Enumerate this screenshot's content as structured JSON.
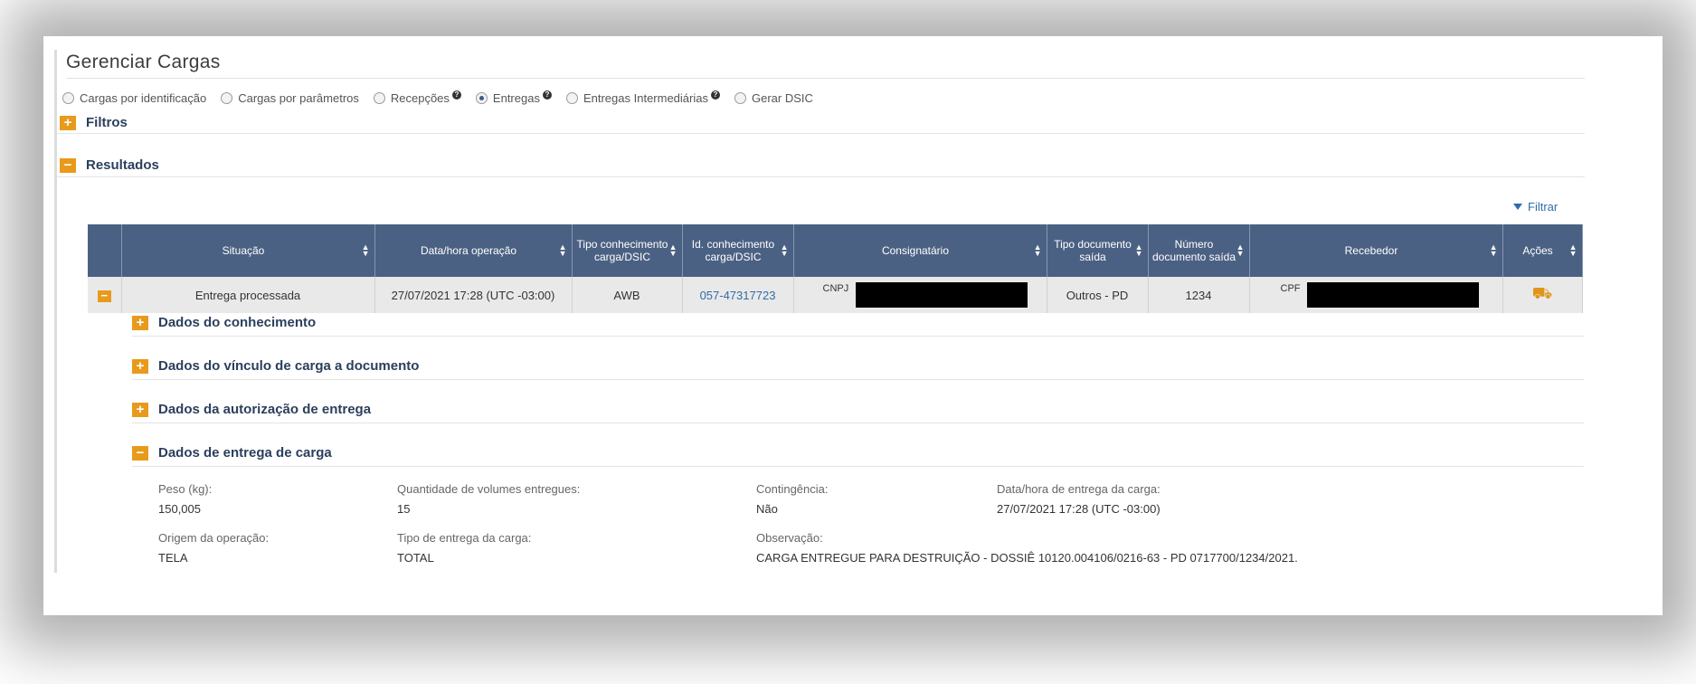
{
  "page_title": "Gerenciar Cargas",
  "radio_options": [
    {
      "label": "Cargas por identificação",
      "checked": false,
      "info": false
    },
    {
      "label": "Cargas por parâmetros",
      "checked": false,
      "info": false
    },
    {
      "label": "Recepções",
      "checked": false,
      "info": true
    },
    {
      "label": "Entregas",
      "checked": true,
      "info": true
    },
    {
      "label": "Entregas Intermediárias",
      "checked": false,
      "info": true
    },
    {
      "label": "Gerar DSIC",
      "checked": false,
      "info": false
    }
  ],
  "sections": {
    "filtros": {
      "label": "Filtros",
      "expanded": false
    },
    "resultados": {
      "label": "Resultados",
      "expanded": true
    }
  },
  "filter_link": "Filtrar",
  "table": {
    "headers": [
      "Situação",
      "Data/hora operação",
      "Tipo conhecimento carga/DSIC",
      "Id. conhecimento carga/DSIC",
      "Consignatário",
      "Tipo documento saída",
      "Número documento saída",
      "Recebedor",
      "Ações"
    ],
    "row": {
      "situacao": "Entrega processada",
      "data_hora": "27/07/2021 17:28 (UTC -03:00)",
      "tipo_conhecimento": "AWB",
      "id_conhecimento": "057-47317723",
      "consignatario_prefix": "CNPJ",
      "tipo_documento": "Outros - PD",
      "numero_documento": "1234",
      "recebedor_prefix": "CPF"
    }
  },
  "subsections": [
    {
      "label": "Dados do conhecimento",
      "expanded": false
    },
    {
      "label": "Dados do vínculo de carga a documento",
      "expanded": false
    },
    {
      "label": "Dados da autorização de entrega",
      "expanded": false
    },
    {
      "label": "Dados de entrega de carga",
      "expanded": true
    }
  ],
  "delivery": {
    "peso_label": "Peso (kg):",
    "peso_value": "150,005",
    "quantidade_label": "Quantidade de volumes entregues:",
    "quantidade_value": "15",
    "contingencia_label": "Contingência:",
    "contingencia_value": "Não",
    "data_entrega_label": "Data/hora de entrega da carga:",
    "data_entrega_value": "27/07/2021 17:28 (UTC -03:00)",
    "origem_label": "Origem da operação:",
    "origem_value": "TELA",
    "tipo_entrega_label": "Tipo de entrega da carga:",
    "tipo_entrega_value": "TOTAL",
    "observacao_label": "Observação:",
    "observacao_value": "CARGA ENTREGUE PARA DESTRUIÇÃO - DOSSIÊ 10120.004106/0216-63 - PD 0717700/1234/2021."
  },
  "icons": {
    "expand": "plus-icon",
    "collapse": "minus-icon",
    "sort": "sort-icon",
    "filter": "funnel-icon",
    "action": "hand-truck-icon",
    "info": "info-icon"
  },
  "colors": {
    "header_bg": "#4b6183",
    "toggle": "#e89a1c",
    "link": "#2f6da8",
    "row_bg": "#e9e9e9"
  }
}
